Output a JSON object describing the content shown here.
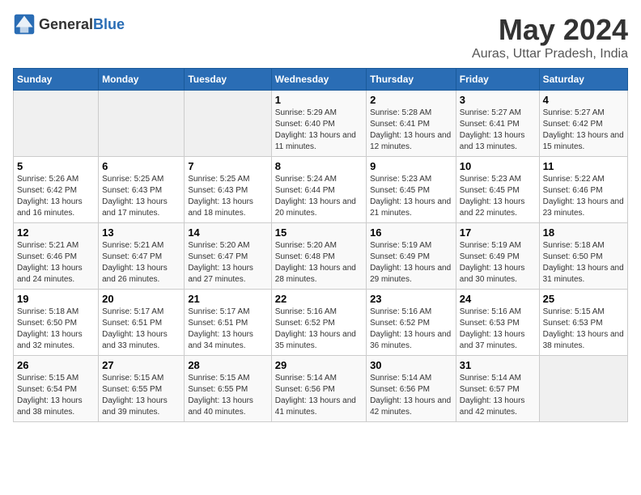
{
  "logo": {
    "general": "General",
    "blue": "Blue"
  },
  "title": "May 2024",
  "subtitle": "Auras, Uttar Pradesh, India",
  "weekdays": [
    "Sunday",
    "Monday",
    "Tuesday",
    "Wednesday",
    "Thursday",
    "Friday",
    "Saturday"
  ],
  "weeks": [
    [
      {
        "day": "",
        "sunrise": "",
        "sunset": "",
        "daylight": ""
      },
      {
        "day": "",
        "sunrise": "",
        "sunset": "",
        "daylight": ""
      },
      {
        "day": "",
        "sunrise": "",
        "sunset": "",
        "daylight": ""
      },
      {
        "day": "1",
        "sunrise": "Sunrise: 5:29 AM",
        "sunset": "Sunset: 6:40 PM",
        "daylight": "Daylight: 13 hours and 11 minutes."
      },
      {
        "day": "2",
        "sunrise": "Sunrise: 5:28 AM",
        "sunset": "Sunset: 6:41 PM",
        "daylight": "Daylight: 13 hours and 12 minutes."
      },
      {
        "day": "3",
        "sunrise": "Sunrise: 5:27 AM",
        "sunset": "Sunset: 6:41 PM",
        "daylight": "Daylight: 13 hours and 13 minutes."
      },
      {
        "day": "4",
        "sunrise": "Sunrise: 5:27 AM",
        "sunset": "Sunset: 6:42 PM",
        "daylight": "Daylight: 13 hours and 15 minutes."
      }
    ],
    [
      {
        "day": "5",
        "sunrise": "Sunrise: 5:26 AM",
        "sunset": "Sunset: 6:42 PM",
        "daylight": "Daylight: 13 hours and 16 minutes."
      },
      {
        "day": "6",
        "sunrise": "Sunrise: 5:25 AM",
        "sunset": "Sunset: 6:43 PM",
        "daylight": "Daylight: 13 hours and 17 minutes."
      },
      {
        "day": "7",
        "sunrise": "Sunrise: 5:25 AM",
        "sunset": "Sunset: 6:43 PM",
        "daylight": "Daylight: 13 hours and 18 minutes."
      },
      {
        "day": "8",
        "sunrise": "Sunrise: 5:24 AM",
        "sunset": "Sunset: 6:44 PM",
        "daylight": "Daylight: 13 hours and 20 minutes."
      },
      {
        "day": "9",
        "sunrise": "Sunrise: 5:23 AM",
        "sunset": "Sunset: 6:45 PM",
        "daylight": "Daylight: 13 hours and 21 minutes."
      },
      {
        "day": "10",
        "sunrise": "Sunrise: 5:23 AM",
        "sunset": "Sunset: 6:45 PM",
        "daylight": "Daylight: 13 hours and 22 minutes."
      },
      {
        "day": "11",
        "sunrise": "Sunrise: 5:22 AM",
        "sunset": "Sunset: 6:46 PM",
        "daylight": "Daylight: 13 hours and 23 minutes."
      }
    ],
    [
      {
        "day": "12",
        "sunrise": "Sunrise: 5:21 AM",
        "sunset": "Sunset: 6:46 PM",
        "daylight": "Daylight: 13 hours and 24 minutes."
      },
      {
        "day": "13",
        "sunrise": "Sunrise: 5:21 AM",
        "sunset": "Sunset: 6:47 PM",
        "daylight": "Daylight: 13 hours and 26 minutes."
      },
      {
        "day": "14",
        "sunrise": "Sunrise: 5:20 AM",
        "sunset": "Sunset: 6:47 PM",
        "daylight": "Daylight: 13 hours and 27 minutes."
      },
      {
        "day": "15",
        "sunrise": "Sunrise: 5:20 AM",
        "sunset": "Sunset: 6:48 PM",
        "daylight": "Daylight: 13 hours and 28 minutes."
      },
      {
        "day": "16",
        "sunrise": "Sunrise: 5:19 AM",
        "sunset": "Sunset: 6:49 PM",
        "daylight": "Daylight: 13 hours and 29 minutes."
      },
      {
        "day": "17",
        "sunrise": "Sunrise: 5:19 AM",
        "sunset": "Sunset: 6:49 PM",
        "daylight": "Daylight: 13 hours and 30 minutes."
      },
      {
        "day": "18",
        "sunrise": "Sunrise: 5:18 AM",
        "sunset": "Sunset: 6:50 PM",
        "daylight": "Daylight: 13 hours and 31 minutes."
      }
    ],
    [
      {
        "day": "19",
        "sunrise": "Sunrise: 5:18 AM",
        "sunset": "Sunset: 6:50 PM",
        "daylight": "Daylight: 13 hours and 32 minutes."
      },
      {
        "day": "20",
        "sunrise": "Sunrise: 5:17 AM",
        "sunset": "Sunset: 6:51 PM",
        "daylight": "Daylight: 13 hours and 33 minutes."
      },
      {
        "day": "21",
        "sunrise": "Sunrise: 5:17 AM",
        "sunset": "Sunset: 6:51 PM",
        "daylight": "Daylight: 13 hours and 34 minutes."
      },
      {
        "day": "22",
        "sunrise": "Sunrise: 5:16 AM",
        "sunset": "Sunset: 6:52 PM",
        "daylight": "Daylight: 13 hours and 35 minutes."
      },
      {
        "day": "23",
        "sunrise": "Sunrise: 5:16 AM",
        "sunset": "Sunset: 6:52 PM",
        "daylight": "Daylight: 13 hours and 36 minutes."
      },
      {
        "day": "24",
        "sunrise": "Sunrise: 5:16 AM",
        "sunset": "Sunset: 6:53 PM",
        "daylight": "Daylight: 13 hours and 37 minutes."
      },
      {
        "day": "25",
        "sunrise": "Sunrise: 5:15 AM",
        "sunset": "Sunset: 6:53 PM",
        "daylight": "Daylight: 13 hours and 38 minutes."
      }
    ],
    [
      {
        "day": "26",
        "sunrise": "Sunrise: 5:15 AM",
        "sunset": "Sunset: 6:54 PM",
        "daylight": "Daylight: 13 hours and 38 minutes."
      },
      {
        "day": "27",
        "sunrise": "Sunrise: 5:15 AM",
        "sunset": "Sunset: 6:55 PM",
        "daylight": "Daylight: 13 hours and 39 minutes."
      },
      {
        "day": "28",
        "sunrise": "Sunrise: 5:15 AM",
        "sunset": "Sunset: 6:55 PM",
        "daylight": "Daylight: 13 hours and 40 minutes."
      },
      {
        "day": "29",
        "sunrise": "Sunrise: 5:14 AM",
        "sunset": "Sunset: 6:56 PM",
        "daylight": "Daylight: 13 hours and 41 minutes."
      },
      {
        "day": "30",
        "sunrise": "Sunrise: 5:14 AM",
        "sunset": "Sunset: 6:56 PM",
        "daylight": "Daylight: 13 hours and 42 minutes."
      },
      {
        "day": "31",
        "sunrise": "Sunrise: 5:14 AM",
        "sunset": "Sunset: 6:57 PM",
        "daylight": "Daylight: 13 hours and 42 minutes."
      },
      {
        "day": "",
        "sunrise": "",
        "sunset": "",
        "daylight": ""
      }
    ]
  ]
}
